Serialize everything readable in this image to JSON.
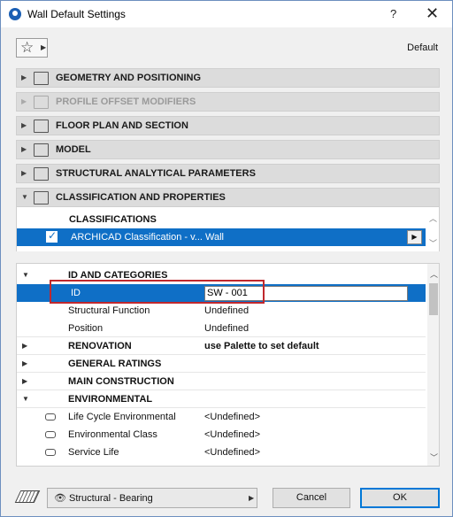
{
  "window": {
    "title": "Wall Default Settings",
    "help": "?",
    "close": "✕"
  },
  "toolbar": {
    "favorites_star": "☆",
    "favorites_arrow": "▶",
    "default_label": "Default"
  },
  "sections": [
    {
      "label": "GEOMETRY AND POSITIONING",
      "enabled": true,
      "icon": "geometry-icon"
    },
    {
      "label": "PROFILE OFFSET MODIFIERS",
      "enabled": false,
      "icon": "profile-offset-icon"
    },
    {
      "label": "FLOOR PLAN AND SECTION",
      "enabled": true,
      "icon": "floor-plan-icon"
    },
    {
      "label": "MODEL",
      "enabled": true,
      "icon": "model-icon"
    },
    {
      "label": "STRUCTURAL ANALYTICAL PARAMETERS",
      "enabled": true,
      "icon": "structural-analytical-icon"
    },
    {
      "label": "CLASSIFICATION AND PROPERTIES",
      "enabled": true,
      "expanded": true,
      "icon": "classification-icon"
    }
  ],
  "classifications": {
    "header": "CLASSIFICATIONS",
    "row_text": "ARCHICAD Classification - v... Wall",
    "checked": true
  },
  "properties": {
    "id_group": "ID AND CATEGORIES",
    "id_label": "ID",
    "id_value": "SW - 001",
    "structural_function_label": "Structural Function",
    "structural_function_value": "Undefined",
    "position_label": "Position",
    "position_value": "Undefined",
    "renovation_label": "RENOVATION",
    "renovation_value": "use Palette to set default",
    "general_ratings_label": "GENERAL RATINGS",
    "main_construction_label": "MAIN CONSTRUCTION",
    "environmental_label": "ENVIRONMENTAL",
    "lce_label": "Life Cycle Environmental",
    "lce_value": "<Undefined>",
    "env_class_label": "Environmental Class",
    "env_class_value": "<Undefined>",
    "service_life_label": "Service Life",
    "service_life_value": "<Undefined>"
  },
  "footer": {
    "layer_value": "Structural - Bearing",
    "cancel_label": "Cancel",
    "ok_label": "OK"
  },
  "colors": {
    "selection": "#0f6fc6",
    "highlight_box": "#c0282d",
    "section_bg": "#dcdcdc"
  }
}
